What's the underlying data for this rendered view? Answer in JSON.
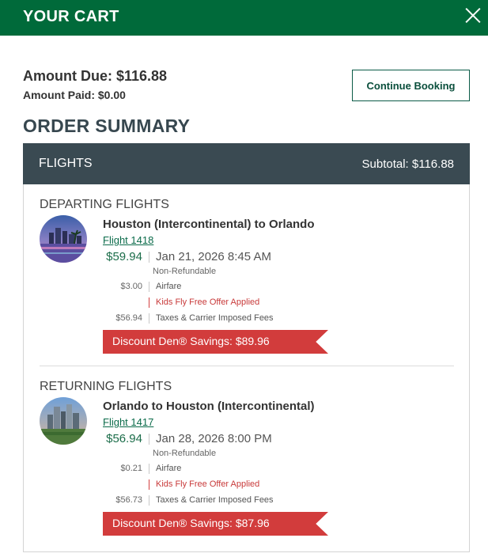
{
  "header": {
    "title": "YOUR CART"
  },
  "summary": {
    "amount_due": "Amount Due: $116.88",
    "amount_paid": "Amount Paid: $0.00",
    "continue_label": "Continue Booking",
    "order_title": "ORDER SUMMARY"
  },
  "flights": {
    "label": "FLIGHTS",
    "subtotal": "Subtotal: $116.88",
    "departing": {
      "section_title": "DEPARTING FLIGHTS",
      "route": "Houston (Intercontinental) to Orlando",
      "flight_link": "Flight 1418",
      "price": "$59.94",
      "datetime": "Jan 21, 2026 8:45 AM",
      "fare_note": "Non-Refundable",
      "airfare_amount": "$3.00",
      "airfare_label": "Airfare",
      "offer": "Kids Fly Free Offer Applied",
      "taxes_amount": "$56.94",
      "taxes_label": "Taxes & Carrier Imposed Fees",
      "savings": "Discount Den® Savings: $89.96"
    },
    "returning": {
      "section_title": "RETURNING FLIGHTS",
      "route": "Orlando to Houston (Intercontinental)",
      "flight_link": "Flight 1417",
      "price": "$56.94",
      "datetime": "Jan 28, 2026 8:00 PM",
      "fare_note": "Non-Refundable",
      "airfare_amount": "$0.21",
      "airfare_label": "Airfare",
      "offer": "Kids Fly Free Offer Applied",
      "taxes_amount": "$56.73",
      "taxes_label": "Taxes & Carrier Imposed Fees",
      "savings": "Discount Den® Savings: $87.96"
    }
  },
  "colors": {
    "header_green": "#006a3a",
    "bar_slate": "#3a4a52",
    "price_green": "#1c6d4a",
    "ribbon_red": "#d23c3c"
  },
  "icons": {
    "close": "close-icon"
  }
}
